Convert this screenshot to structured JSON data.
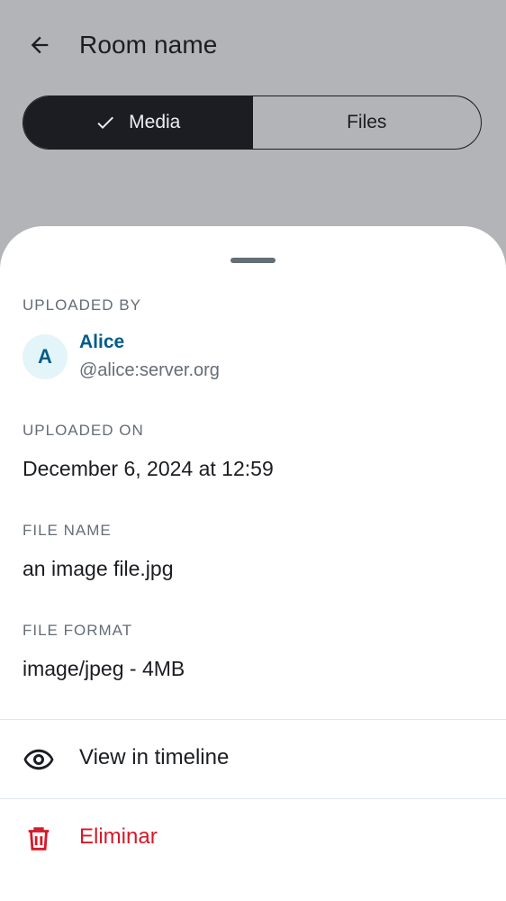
{
  "header": {
    "title": "Room name",
    "back_icon": "arrow-left-icon"
  },
  "segments": {
    "media_label": "Media",
    "files_label": "Files",
    "selected": "Media"
  },
  "sheet": {
    "uploaded_by_label": "UPLOADED BY",
    "user": {
      "avatar_letter": "A",
      "name": "Alice",
      "id": "@alice:server.org"
    },
    "uploaded_on_label": "UPLOADED ON",
    "uploaded_on_value": "December 6, 2024 at 12:59",
    "file_name_label": "FILE NAME",
    "file_name_value": "an image file.jpg",
    "file_format_label": "FILE FORMAT",
    "file_format_value": "image/jpeg - 4MB",
    "actions": [
      {
        "label": "View in timeline",
        "icon": "eye-icon",
        "color": "#1b1d22"
      },
      {
        "label": "Eliminar",
        "icon": "trash-icon",
        "color": "#d51928"
      }
    ]
  },
  "colors": {
    "scrim": "#b3b4b7",
    "accent": "#005c8a",
    "danger": "#d51928",
    "text_primary": "#1b1d22",
    "text_secondary": "#656d77"
  }
}
